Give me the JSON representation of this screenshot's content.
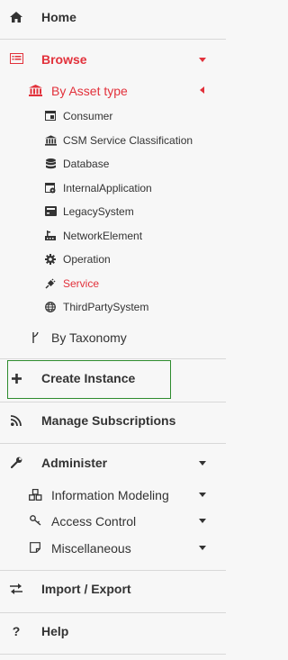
{
  "nav": {
    "home": {
      "label": "Home",
      "icon": "home-icon"
    },
    "browse": {
      "label": "Browse",
      "icon": "browse-list-icon",
      "by_asset_type": {
        "label": "By Asset type",
        "icon": "bank-icon",
        "items": [
          {
            "label": "Consumer",
            "icon": "consumer-window-icon"
          },
          {
            "label": "CSM Service Classification",
            "icon": "bank-icon"
          },
          {
            "label": "Database",
            "icon": "database-icon"
          },
          {
            "label": "InternalApplication",
            "icon": "internal-application-icon"
          },
          {
            "label": "LegacySystem",
            "icon": "legacy-system-icon"
          },
          {
            "label": "NetworkElement",
            "icon": "network-element-icon"
          },
          {
            "label": "Operation",
            "icon": "gear-icon"
          },
          {
            "label": "Service",
            "icon": "plug-icon",
            "active": true
          },
          {
            "label": "ThirdPartySystem",
            "icon": "globe-icon"
          }
        ]
      },
      "by_taxonomy": {
        "label": "By Taxonomy",
        "icon": "taxonomy-icon"
      }
    },
    "create_instance": {
      "label": "Create Instance",
      "icon": "plus-icon"
    },
    "manage_subscriptions": {
      "label": "Manage Subscriptions",
      "icon": "rss-icon"
    },
    "administer": {
      "label": "Administer",
      "icon": "wrench-icon",
      "items": [
        {
          "label": "Information Modeling",
          "icon": "cubes-icon"
        },
        {
          "label": "Access Control",
          "icon": "key-icon"
        },
        {
          "label": "Miscellaneous",
          "icon": "note-icon"
        }
      ]
    },
    "import_export": {
      "label": "Import / Export",
      "icon": "exchange-icon"
    },
    "help": {
      "label": "Help",
      "icon": "question-icon"
    }
  },
  "colors": {
    "accent": "#e2313b",
    "highlight_border": "#2e8b2e",
    "background": "#f7f7f7"
  }
}
